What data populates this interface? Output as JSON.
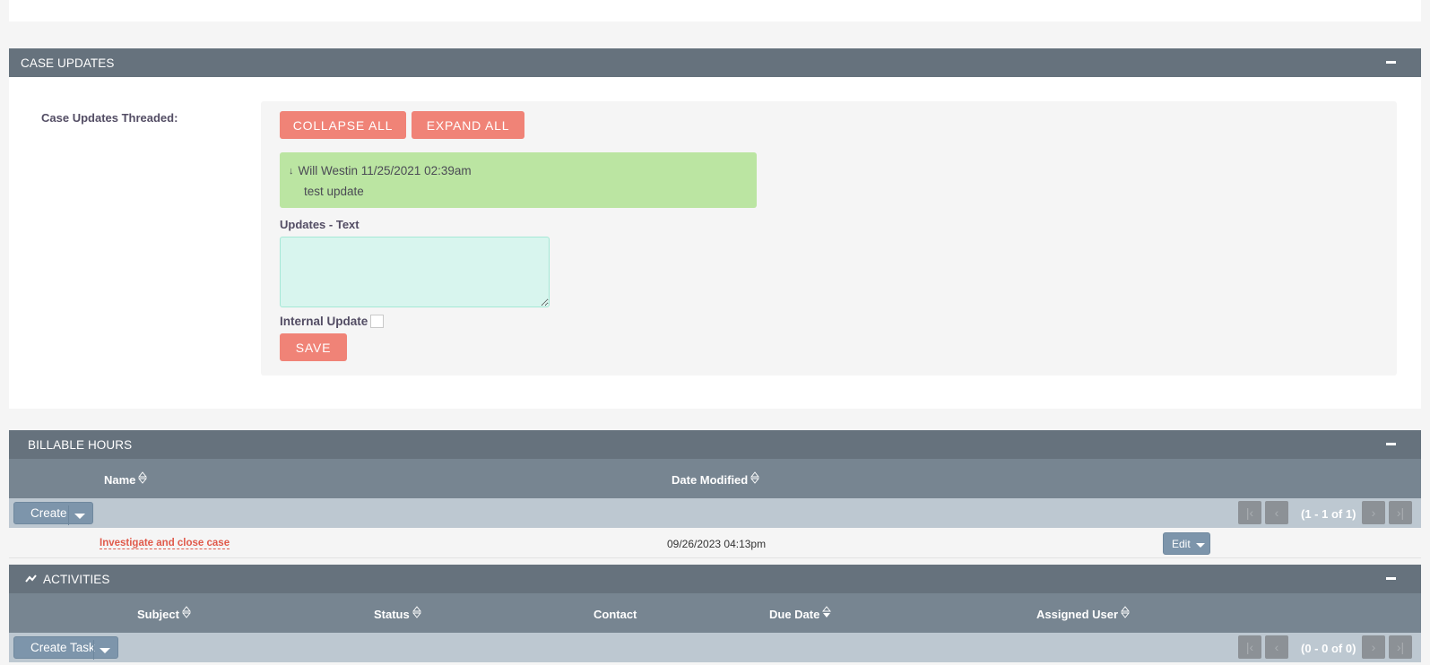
{
  "case_updates": {
    "header": "CASE UPDATES",
    "threaded_label": "Case Updates Threaded:",
    "collapse_all": "COLLAPSE ALL",
    "expand_all": "EXPAND ALL",
    "thread": {
      "author_date": "Will Westin 11/25/2021 02:39am",
      "text": "test update"
    },
    "updates_text_label": "Updates - Text",
    "updates_text_value": "",
    "internal_update_label": "Internal Update",
    "internal_update_checked": false,
    "save": "SAVE"
  },
  "billable_hours": {
    "header": "BILLABLE HOURS",
    "columns": [
      "Name",
      "Date Modified"
    ],
    "create": "Create",
    "pagination": "(1 - 1 of 1)",
    "rows": [
      {
        "name": "Investigate and close case",
        "date_modified": "09/26/2023 04:13pm",
        "action": "Edit"
      }
    ]
  },
  "activities": {
    "header": "ACTIVITIES",
    "columns": [
      "Subject",
      "Status",
      "Contact",
      "Due Date",
      "Assigned User"
    ],
    "create_task": "Create Task",
    "pagination": "(0 - 0 of 0)"
  },
  "colors": {
    "panel_header": "#66727d",
    "accent": "#f08377",
    "thread_bg": "#bbe5a2",
    "link": "#e05a4b"
  }
}
